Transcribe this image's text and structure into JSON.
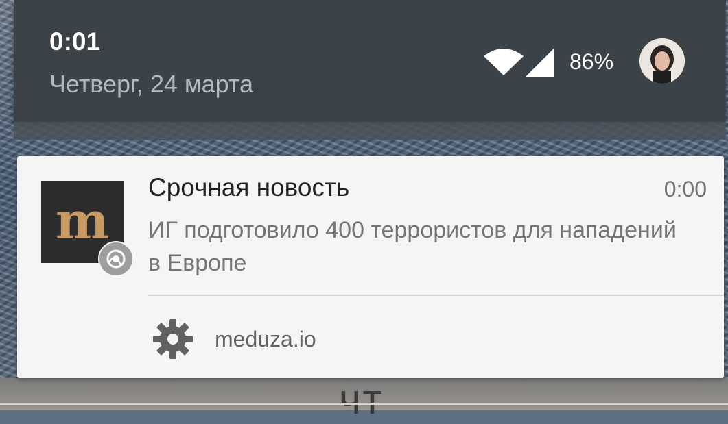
{
  "status_header": {
    "time": "0:01",
    "date": "Четверг, 24 марта",
    "battery": "86%",
    "icons": [
      "wifi-icon",
      "signal-icon",
      "avatar"
    ]
  },
  "notification": {
    "title": "Срочная новость",
    "time": "0:00",
    "body": "ИГ подготовило 400 террористов для нападений в Европе",
    "source": "meduza.io",
    "app_icon": "meduza-logo-icon",
    "badge_icon": "chrome-icon",
    "action_icon": "gear-icon"
  },
  "background": {
    "partial_text": "чт"
  },
  "colors": {
    "header_bg": "#3b4248",
    "card_bg": "#f5f5f5",
    "logo_accent": "#c79a63"
  }
}
